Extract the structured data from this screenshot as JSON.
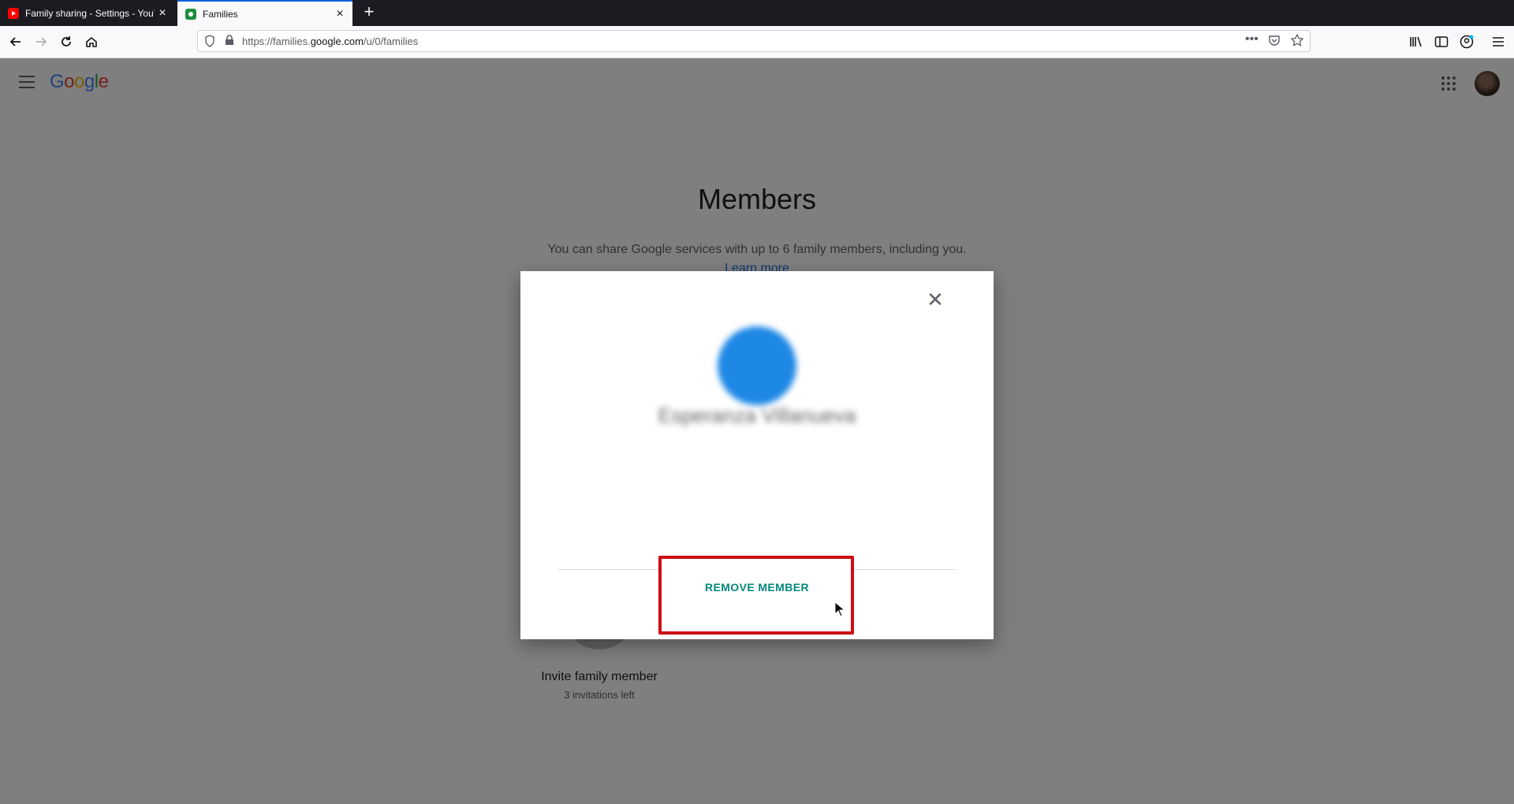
{
  "browser": {
    "tabs": [
      {
        "title": "Family sharing - Settings - YouT",
        "favicon": "youtube-icon",
        "active": false
      },
      {
        "title": "Families",
        "favicon": "google-families-icon",
        "active": true
      }
    ],
    "url_prefix": "https://families.",
    "url_domain": "google.com",
    "url_path": "/u/0/families"
  },
  "header": {
    "logo_letters": [
      "G",
      "o",
      "o",
      "g",
      "l",
      "e"
    ],
    "logo_colors": [
      "#4285f4",
      "#ea4335",
      "#fbbc05",
      "#4285f4",
      "#34a853",
      "#ea4335"
    ]
  },
  "page": {
    "title": "Members",
    "subtitle": "You can share Google services with up to 6 family members, including you.",
    "learn_more": "Learn more",
    "invite_label": "Invite family member",
    "invite_sub": "3 invitations left"
  },
  "dialog": {
    "member_name": "Esperanza Villanueva",
    "remove_label": "REMOVE MEMBER",
    "accent_color": "#00897b",
    "highlight_color": "#cc0f14"
  }
}
